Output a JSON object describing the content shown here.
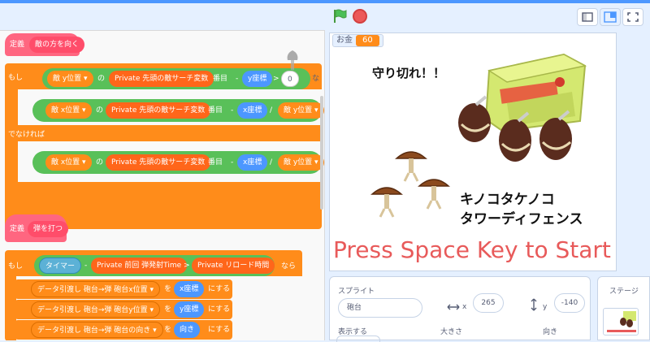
{
  "header": {
    "green_flag": "green-flag-icon",
    "stop": "stop-icon"
  },
  "code": {
    "define1": {
      "define_label": "定義",
      "name": "敵の方を向く"
    },
    "if1": {
      "if_label": "もし",
      "then_label": "な"
    },
    "row1": {
      "enemy_y": "敵 y位置 ▾",
      "of": "の",
      "var": "Private 先頭の敵サーチ変数",
      "index": "番目",
      "minus": "-",
      "y_coord": "y座標",
      "gt": ">",
      "zero": "0"
    },
    "row2": {
      "enemy_x": "敵 x位置 ▾",
      "of": "の",
      "var": "Private 先頭の敵サーチ変数",
      "index": "番目",
      "minus": "-",
      "x_coord": "x座標",
      "div": "/",
      "enemy_y": "敵 y位置 ▾"
    },
    "else_label": "でなければ",
    "row3": {
      "enemy_x": "敵 x位置 ▾",
      "of": "の",
      "var": "Private 先頭の敵サーチ変数",
      "index": "番目",
      "minus": "-",
      "x_coord": "x座標",
      "div": "/",
      "enemy_y": "敵 y位置 ▾"
    },
    "define2": {
      "define_label": "定義",
      "name": "弾を打つ"
    },
    "if2": {
      "if_label": "もし",
      "timer": "タイマー",
      "minus": "-",
      "last_shot": "Private 前回 弾発射Time",
      "gt": ">",
      "reload": "Private リロード時間",
      "then_label": "なら"
    },
    "data_rows": [
      {
        "block": "データ引渡し 砲台→弾 砲台x位置 ▾",
        "wo": "を",
        "value": "x座標",
        "suru": "にする"
      },
      {
        "block": "データ引渡し 砲台→弾 砲台y位置 ▾",
        "wo": "を",
        "value": "y座標",
        "suru": "にする"
      },
      {
        "block": "データ引渡し 砲台→弾 砲台の向き ▾",
        "wo": "を",
        "value": "向き",
        "suru": "にする"
      }
    ]
  },
  "stage": {
    "monitor_label": "お金",
    "monitor_value": "60",
    "top_text": "守り切れ！！",
    "title_line1": "キノコタケノコ",
    "title_line2": "タワーディフェンス",
    "press_text": "Press Space Key to Start",
    "accent": "#e85a5a"
  },
  "sprite_panel": {
    "sprite_label": "スプライト",
    "sprite_name": "砲台",
    "x_label": "x",
    "x_value": "265",
    "y_label": "y",
    "y_value": "-140",
    "show_label": "表示する",
    "size_label": "大きさ",
    "direction_label": "向き"
  },
  "stage_panel": {
    "title": "ステージ"
  }
}
